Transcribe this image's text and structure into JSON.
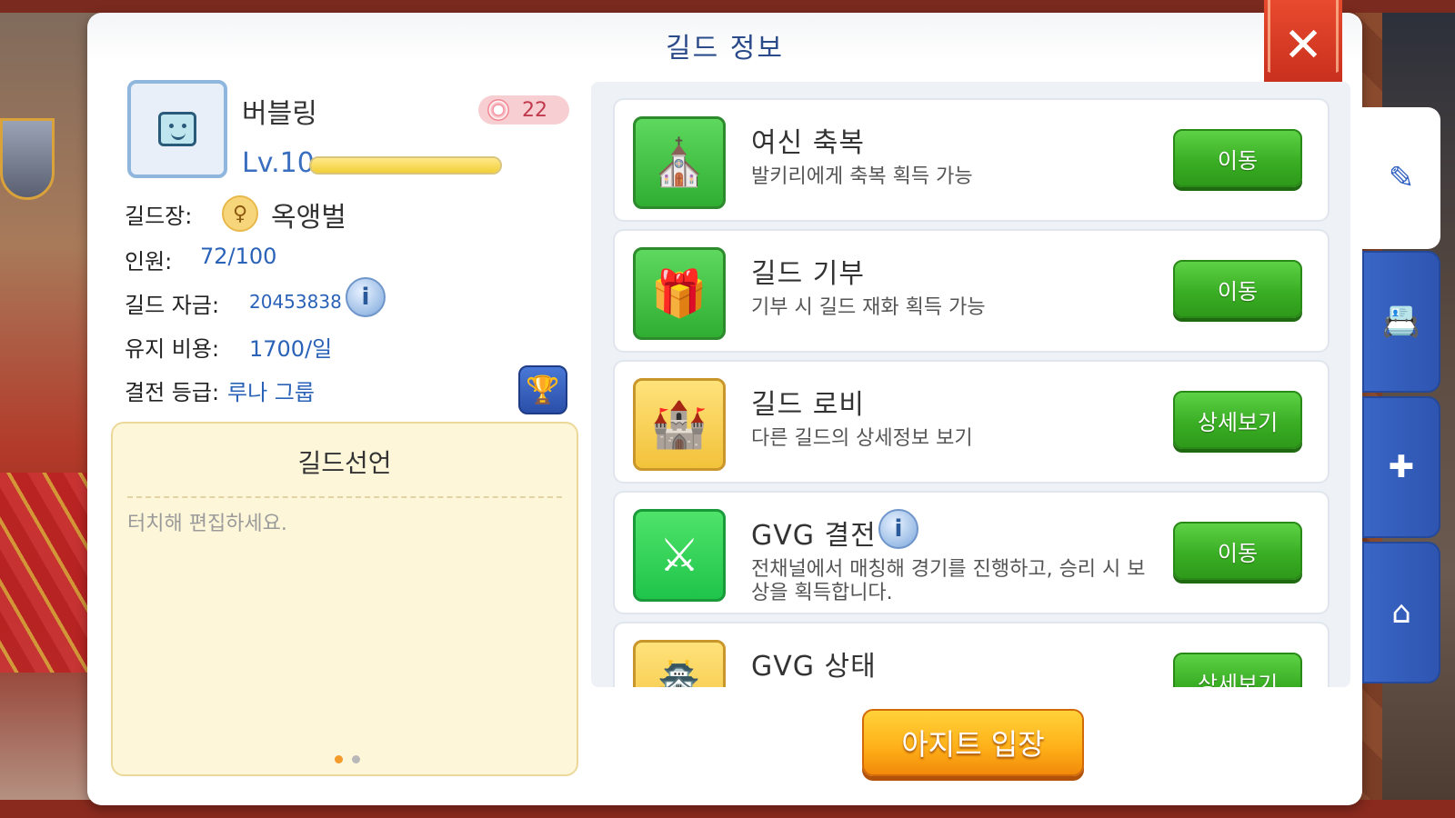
{
  "window": {
    "title": "길드 정보"
  },
  "guild": {
    "name": "버블링",
    "emblem_count": "22",
    "level": "Lv.10",
    "level_progress": 1.0,
    "master_label": "길드장:",
    "master_name": "옥앵벌",
    "members_label": "인원:",
    "members_value": "72/100",
    "funds_label": "길드 자금:",
    "funds_value": "20453838",
    "upkeep_label": "유지 비용:",
    "upkeep_value": "1700/일",
    "rank_label": "결전 등급:",
    "rank_value": "루나 그룹"
  },
  "declaration": {
    "title": "길드선언",
    "placeholder": "터치해 편집하세요.",
    "page_count": 2,
    "active_page": 1
  },
  "features": [
    {
      "title": "여신 축복",
      "desc": "발키리에게 축복 획득 가능",
      "button": "이동",
      "icon": "goddess-blessing-icon",
      "icon_color": "green"
    },
    {
      "title": "길드 기부",
      "desc": "기부 시 길드 재화 획득 가능",
      "button": "이동",
      "icon": "donation-box-icon",
      "icon_color": "green"
    },
    {
      "title": "길드 로비",
      "desc": "다른 길드의 상세정보 보기",
      "button": "상세보기",
      "icon": "castle-icon",
      "icon_color": "yellow"
    },
    {
      "title": "GVG 결전",
      "desc": "전채널에서 매칭해 경기를 진행하고, 승리 시 보상을 획득합니다.",
      "button": "이동",
      "icon": "crossed-swords-icon",
      "icon_color": "brightgreen"
    },
    {
      "title": "GVG 상태",
      "desc": "",
      "button": "상세보기",
      "icon": "castle-flag-icon",
      "icon_color": "yellow"
    }
  ],
  "enter_button": "아지트 입장",
  "side_tabs": [
    {
      "icon": "edit-icon",
      "active": true
    },
    {
      "icon": "contacts-book-icon",
      "active": false
    },
    {
      "icon": "holy-cross-icon",
      "active": false
    },
    {
      "icon": "guild-home-icon",
      "active": false
    }
  ],
  "colors": {
    "title_blue": "#2b4a8a",
    "value_blue": "#2a62b8",
    "button_green": "#3aae24",
    "button_orange": "#ffb21a",
    "close_red": "#d63a22",
    "tab_blue": "#2e55b0"
  }
}
